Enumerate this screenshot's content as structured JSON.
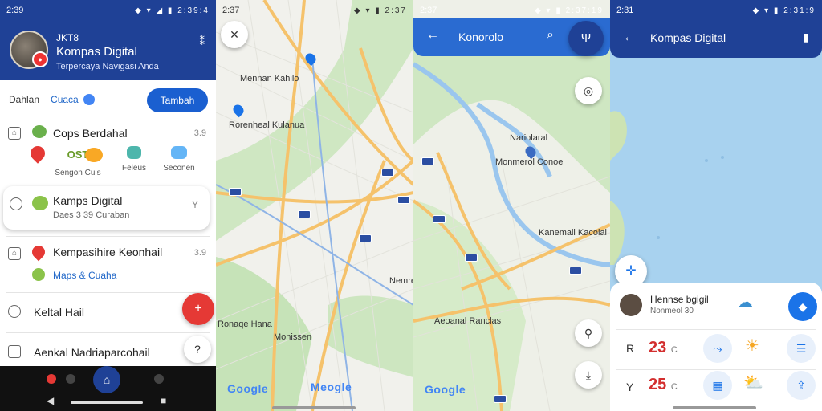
{
  "panel1": {
    "status": {
      "time": "2:39",
      "icons": "◆ ▾ ◢ ▮ 2:39:4"
    },
    "header": {
      "line1": "JKT8",
      "title": "Kompas Digital",
      "subtitle": "Terpercaya Navigasi Anda"
    },
    "toolbar": {
      "label": "Dahlan",
      "link": "Cuaca",
      "button": "Tambah"
    },
    "rows": [
      {
        "title": "Cops Berdahal",
        "meta": "3.9"
      },
      {
        "title": "Kempasihire Keonhail",
        "meta": "3.9"
      },
      {
        "title": "Keltal Hail"
      },
      {
        "title": "Aenkal Nadriaparcohail"
      }
    ],
    "tiles": [
      {
        "label": "OST",
        "caption": "Sengon Culs"
      },
      {
        "caption": "Feleus"
      },
      {
        "caption": "Seconen"
      }
    ],
    "card": {
      "title": "Kamps Digital",
      "subtitle": "Daes 3 39 Curaban",
      "more": "Y"
    },
    "row2_sub": "Maps & Cuaha"
  },
  "panel2": {
    "status": {
      "time": "2:37",
      "icons": "◆ ▾ ▮ 2:37"
    },
    "labels": [
      "Mennan Kahilo",
      "Rorenheal Kulanua",
      "Nemreck",
      "Ronaqe Hana",
      "Monissen"
    ],
    "google": [
      "Google",
      "Meogle"
    ]
  },
  "panel3": {
    "status": {
      "time": "2:37",
      "icons": "◆ ▾ ▮ 2:37:19"
    },
    "header": {
      "title": "Konorolo"
    },
    "labels": [
      "Nariolaral",
      "Monmerol Conoe",
      "Kanemall Kacolal",
      "Aeoanal Ranclas"
    ],
    "google": "Google"
  },
  "panel4": {
    "status": {
      "time": "2:31",
      "icons": "◆ ▾ ▮ 2:31:9"
    },
    "header": {
      "title": "Kompas Digital"
    },
    "sheet": {
      "name": "Hennse bgigil",
      "sub": "Nonmeol 30",
      "row1": {
        "label": "R",
        "value": "23",
        "unit": "C"
      },
      "row2": {
        "label": "Y",
        "value": "25",
        "unit": "C"
      }
    }
  }
}
